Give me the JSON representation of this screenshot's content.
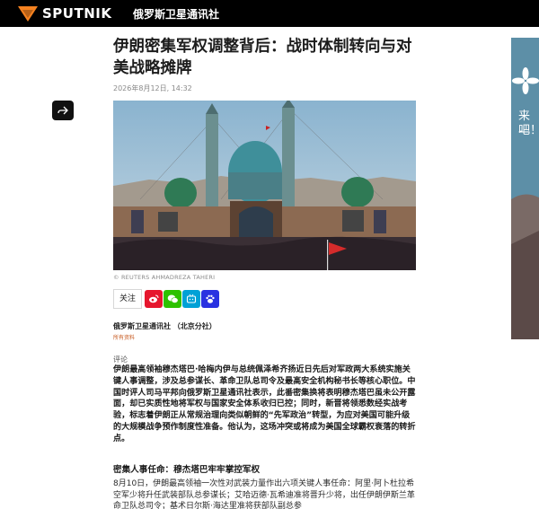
{
  "header": {
    "logo_text": "SPUTNIK",
    "site_name": "俄罗斯卫星通讯社"
  },
  "article": {
    "title": "伊朗密集军权调整背后：战时体制转向与对美战略摊牌",
    "date": "2026年8月12日, 14:32",
    "photo_credit": "© REUTERS AHMADREZA TAHERI",
    "follow_label": "关注",
    "agency": "俄罗斯卫星通讯社 （北京分社）",
    "rights": "所有资料",
    "section_label": "评论",
    "lead": "伊朗最高领袖穆杰塔巴·哈梅内伊与总统佩泽希齐扬近日先后对军政两大系统实施关键人事调整，涉及总参谋长、革命卫队总司令及最高安全机构秘书长等核心职位。中国时评人司马平邦向俄罗斯卫星通讯社表示，此番密集换将表明穆杰塔巴虽未公开露面，却已实质性地将军权与国家安全体系收归已控；同时，新晋将领悉数经实战考验，标志着伊朗正从常规治理向类似朝鲜的“先军政治”转型，为应对美国可能升级的大规模战争预作制度性准备。他认为，这场冲突或将成为美国全球霸权衰落的转折点。",
    "subhead": "密集人事任命：穆杰塔巴牢牢掌控军权",
    "body": "8月10日，伊朗最高领袖一次性对武装力量作出六项关键人事任命：阿里·阿卜杜拉希空军少将升任武装部队总参谋长；艾哈迈德·瓦希迪准将晋升少将，出任伊朗伊斯兰革命卫队总司令；基术日尔斯·海达里准将获部队副总参"
  },
  "social": [
    {
      "name": "weibo",
      "color": "#e6162d"
    },
    {
      "name": "wechat",
      "color": "#2dc100"
    },
    {
      "name": "bilibili",
      "color": "#00a1d6"
    },
    {
      "name": "baidu",
      "color": "#2932e1"
    }
  ],
  "ad": {
    "line1": "来一",
    "line2": "吧！",
    "small": "steinl"
  },
  "colors": {
    "brand": "#f58220",
    "header_bg": "#000000"
  }
}
